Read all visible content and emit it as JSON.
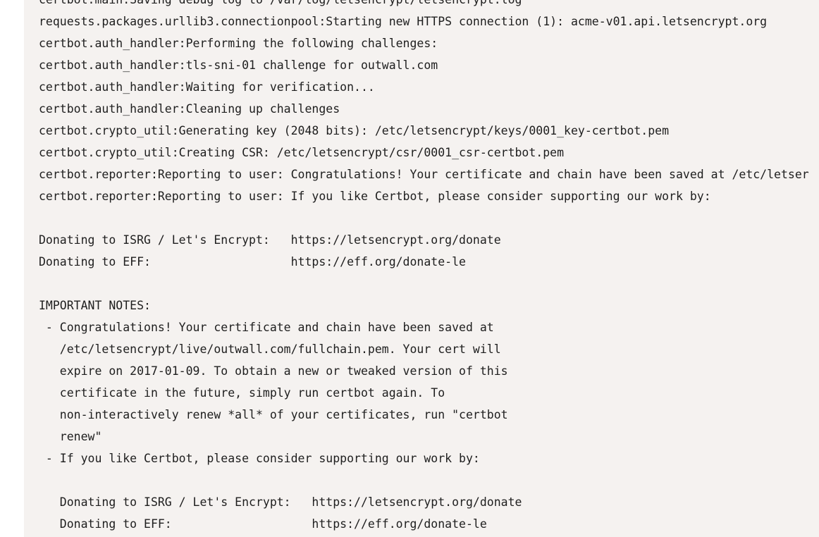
{
  "code_block": {
    "lines": [
      "certbot.main:Saving debug log to /var/log/letsencrypt/letsencrypt.log",
      "requests.packages.urllib3.connectionpool:Starting new HTTPS connection (1): acme-v01.api.letsencrypt.org",
      "certbot.auth_handler:Performing the following challenges:",
      "certbot.auth_handler:tls-sni-01 challenge for outwall.com",
      "certbot.auth_handler:Waiting for verification...",
      "certbot.auth_handler:Cleaning up challenges",
      "certbot.crypto_util:Generating key (2048 bits): /etc/letsencrypt/keys/0001_key-certbot.pem",
      "certbot.crypto_util:Creating CSR: /etc/letsencrypt/csr/0001_csr-certbot.pem",
      "certbot.reporter:Reporting to user: Congratulations! Your certificate and chain have been saved at /etc/letser",
      "certbot.reporter:Reporting to user: If you like Certbot, please consider supporting our work by:",
      "",
      "Donating to ISRG / Let's Encrypt:   https://letsencrypt.org/donate",
      "Donating to EFF:                    https://eff.org/donate-le",
      "",
      "IMPORTANT NOTES:",
      " - Congratulations! Your certificate and chain have been saved at",
      "   /etc/letsencrypt/live/outwall.com/fullchain.pem. Your cert will",
      "   expire on 2017-01-09. To obtain a new or tweaked version of this",
      "   certificate in the future, simply run certbot again. To",
      "   non-interactively renew *all* of your certificates, run \"certbot",
      "   renew\"",
      " - If you like Certbot, please consider supporting our work by:",
      "",
      "   Donating to ISRG / Let's Encrypt:   https://letsencrypt.org/donate",
      "   Donating to EFF:                    https://eff.org/donate-le"
    ]
  }
}
